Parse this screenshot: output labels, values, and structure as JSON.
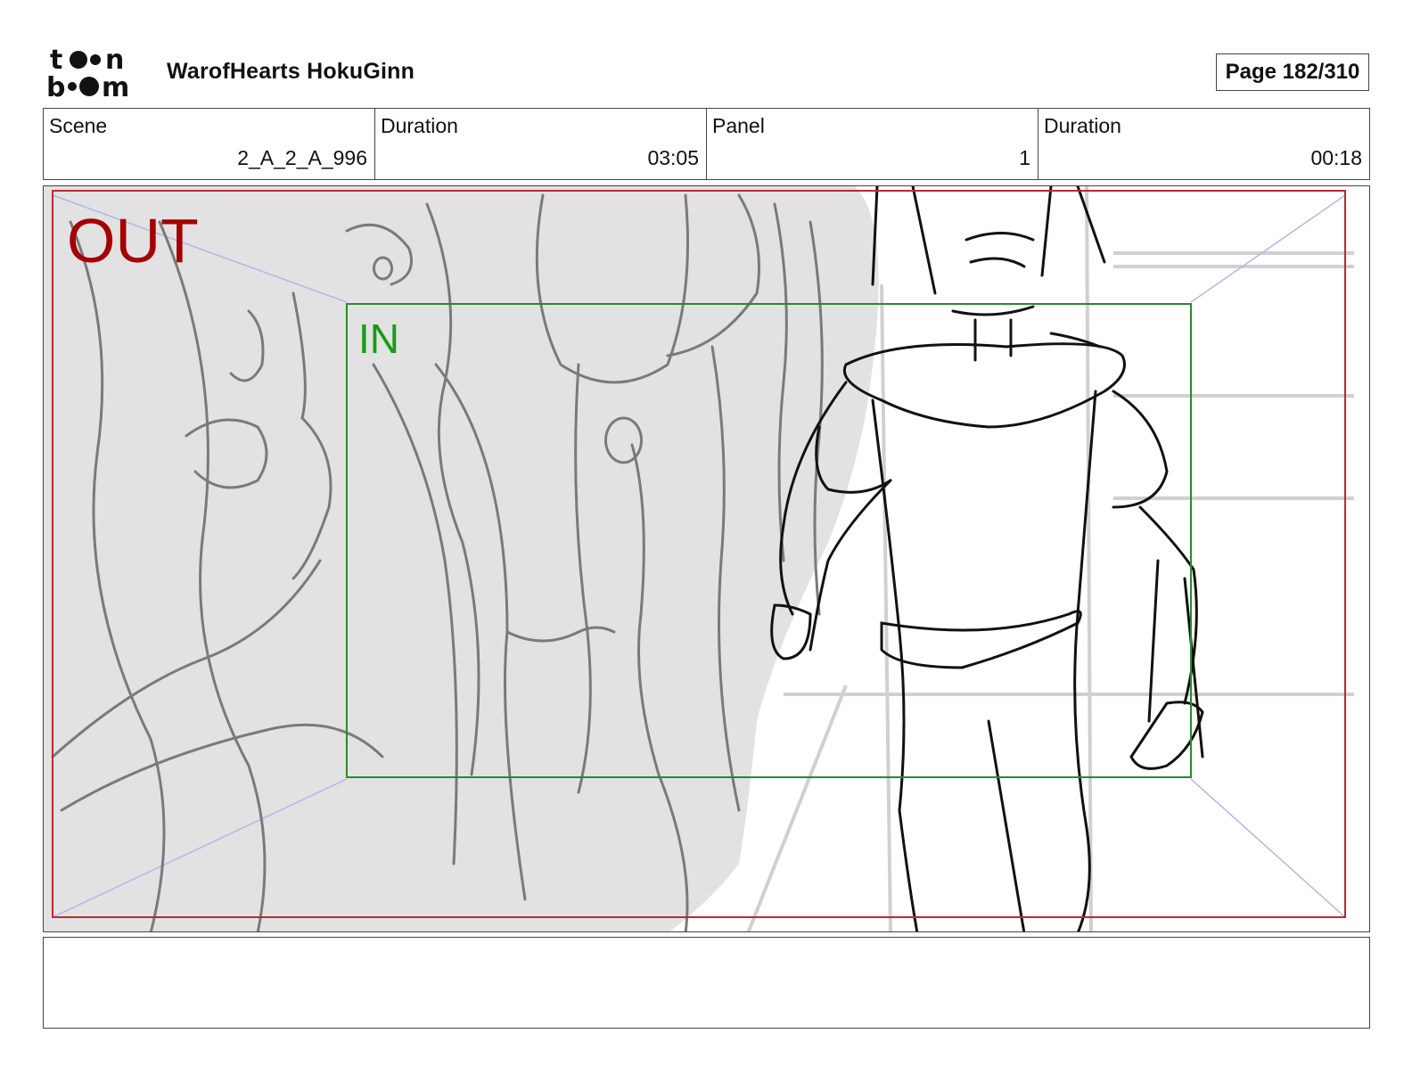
{
  "header": {
    "logo_text": "toonboom",
    "project_title": "WarofHearts HokuGinn",
    "page": "Page 182/310"
  },
  "info": {
    "scene_label": "Scene",
    "scene_value": "2_A_2_A_996",
    "scene_duration_label": "Duration",
    "scene_duration_value": "03:05",
    "panel_label": "Panel",
    "panel_value": "1",
    "panel_duration_label": "Duration",
    "panel_duration_value": "00:18"
  },
  "panel": {
    "out_label": "OUT",
    "in_label": "IN"
  },
  "colors": {
    "out_frame": "#c0282e",
    "in_frame": "#2a8a2a",
    "perspective_lines": "#b5b5ea",
    "background_fill": "#e2e2e2"
  },
  "notes": {
    "text": ""
  }
}
